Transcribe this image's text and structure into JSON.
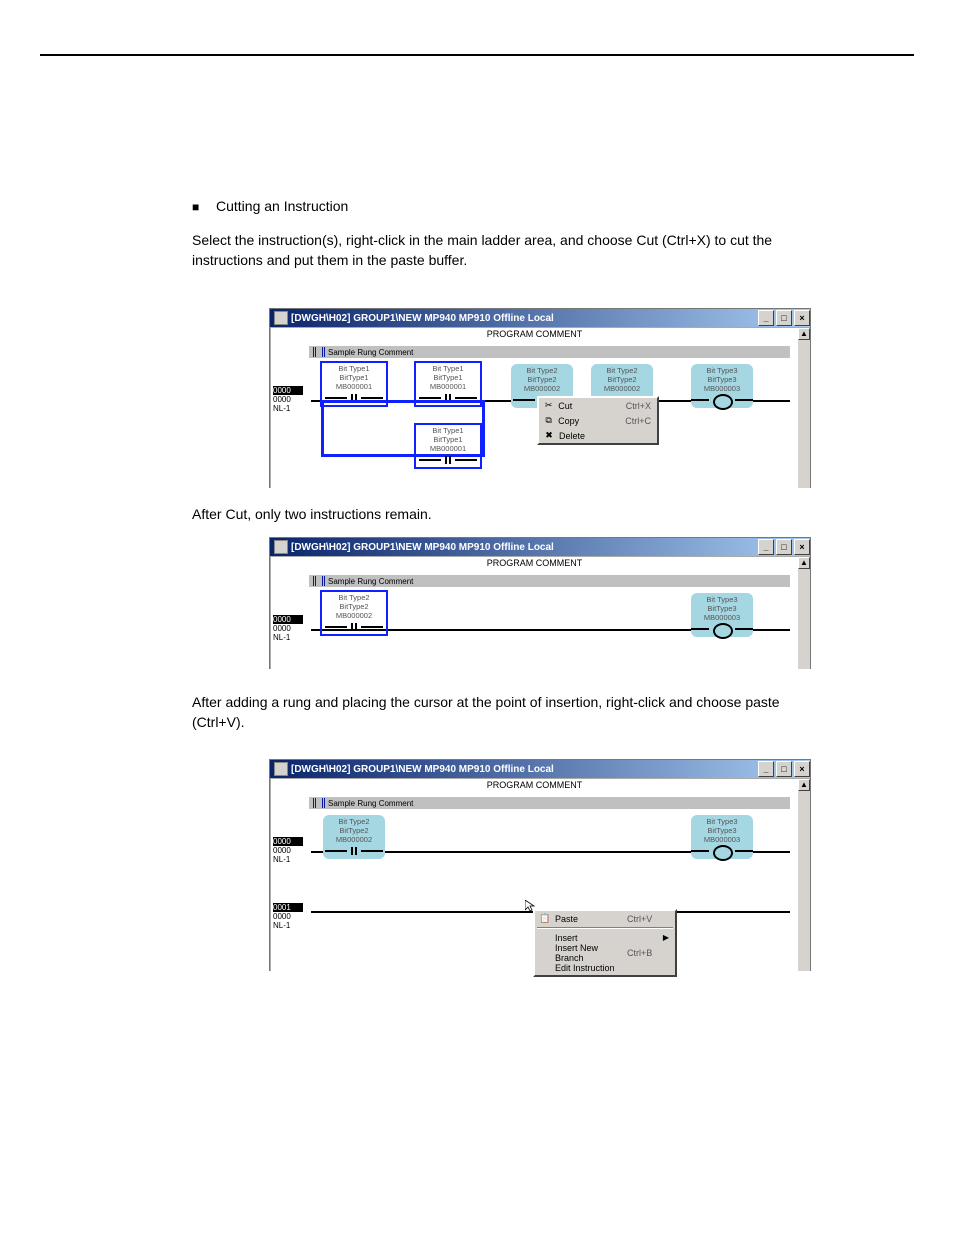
{
  "title_bar": {
    "title": "[DWGH\\H02]    GROUP1\\NEW  MP940  MP910      Offline  Local",
    "program_comment": "PROGRAM COMMENT",
    "rung_comment": "Sample Rung Comment",
    "btn_min": "_",
    "btn_max": "□",
    "btn_close": "×"
  },
  "body_text": {
    "heading": "Cutting an Instruction",
    "para1": "Select the instruction(s), right-click in the main ladder area, and choose Cut (Ctrl+X) to cut the instructions and put them in the paste buffer.",
    "after_cut": "After Cut, only two instructions remain.",
    "para2": "After adding a rung and placing the cursor at the point of insertion, right-click and choose paste (Ctrl+V)."
  },
  "labels": {
    "bt1a": "Bit Type1",
    "bt1b": "BitType1",
    "mb1": "MB000001",
    "bt2a": "Bit Type2",
    "bt2b": "BitType2",
    "mb2": "MB000002",
    "bt3a": "Bit Type3",
    "bt3b": "BitType3",
    "mb3": "MB000003"
  },
  "ctx_cut": {
    "cut": "Cut",
    "cut_sc": "Ctrl+X",
    "copy": "Copy",
    "copy_sc": "Ctrl+C",
    "del": "Delete"
  },
  "ctx_paste": {
    "paste": "Paste",
    "paste_sc": "Ctrl+V",
    "insert": "Insert",
    "newbranch": "Insert New Branch",
    "newbranch_sc": "Ctrl+B",
    "editinst": "Edit Instruction"
  },
  "gutter": {
    "a": "0000",
    "b": "0000",
    "c": "NL-1",
    "a2": "0001"
  }
}
